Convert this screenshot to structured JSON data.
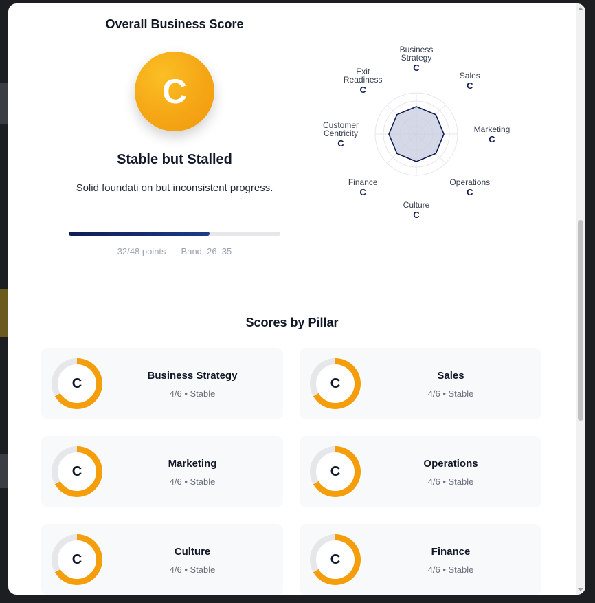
{
  "overall": {
    "title": "Overall Business Score",
    "grade": "C",
    "status": "Stable but Stalled",
    "description": "Solid foundati on but inconsistent progress.",
    "points": "32/48 points",
    "band": "Band: 26–35",
    "progress_fraction": 0.667
  },
  "radar": {
    "labels": [
      {
        "name": "Business\nStrategy",
        "grade": "C"
      },
      {
        "name": "Sales",
        "grade": "C"
      },
      {
        "name": "Marketing",
        "grade": "C"
      },
      {
        "name": "Operations",
        "grade": "C"
      },
      {
        "name": "Culture",
        "grade": "C"
      },
      {
        "name": "Finance",
        "grade": "C"
      },
      {
        "name": "Customer\nCentricity",
        "grade": "C"
      },
      {
        "name": "Exit\nReadiness",
        "grade": "C"
      }
    ],
    "value_fraction": 0.667,
    "colors": {
      "fill": "#c7ccdf",
      "stroke": "#0f1d52",
      "grid": "#e5e7eb"
    }
  },
  "pillars": {
    "title": "Scores by Pillar",
    "items": [
      {
        "name": "Business Strategy",
        "grade": "C",
        "detail": "4/6 • Stable",
        "fraction": 0.667
      },
      {
        "name": "Sales",
        "grade": "C",
        "detail": "4/6 • Stable",
        "fraction": 0.667
      },
      {
        "name": "Marketing",
        "grade": "C",
        "detail": "4/6 • Stable",
        "fraction": 0.667
      },
      {
        "name": "Operations",
        "grade": "C",
        "detail": "4/6 • Stable",
        "fraction": 0.667
      },
      {
        "name": "Culture",
        "grade": "C",
        "detail": "4/6 • Stable",
        "fraction": 0.667
      },
      {
        "name": "Finance",
        "grade": "C",
        "detail": "4/6 • Stable",
        "fraction": 0.667
      }
    ]
  },
  "colors": {
    "accent": "#f59e0b",
    "track": "#e5e7eb",
    "navy": "#0f1d52"
  }
}
